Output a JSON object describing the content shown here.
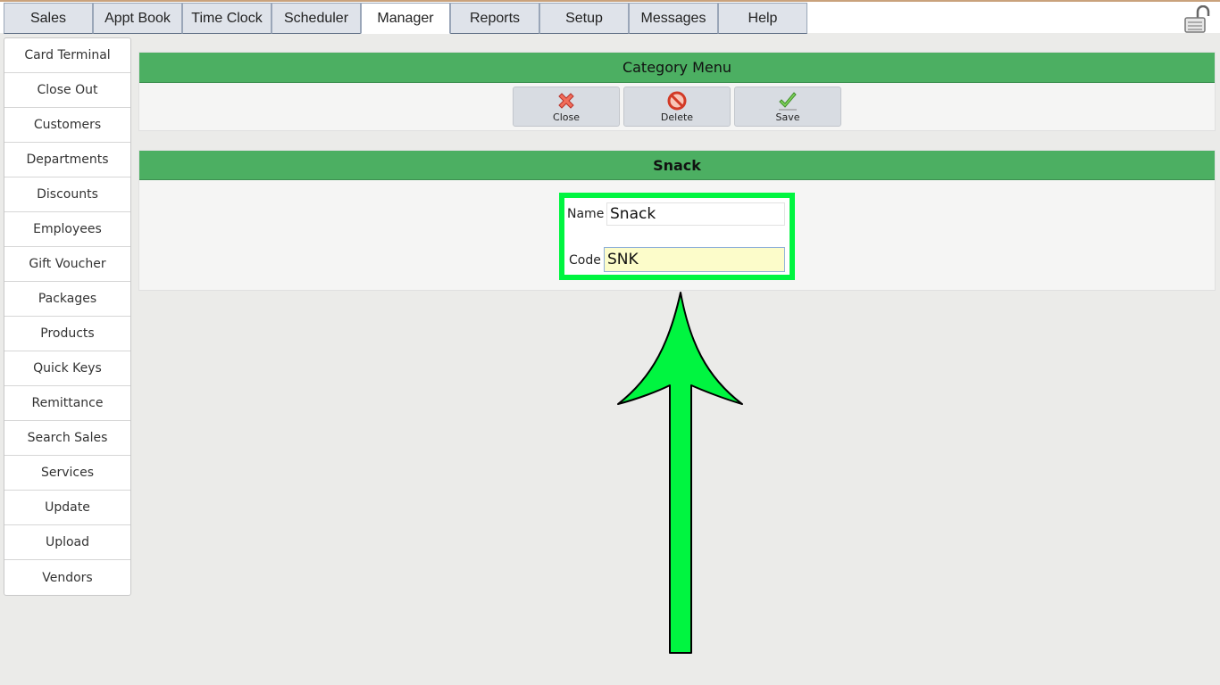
{
  "nav": {
    "tabs": [
      {
        "label": "Sales"
      },
      {
        "label": "Appt Book"
      },
      {
        "label": "Time Clock"
      },
      {
        "label": "Scheduler"
      },
      {
        "label": "Manager",
        "active": true
      },
      {
        "label": "Reports"
      },
      {
        "label": "Setup"
      },
      {
        "label": "Messages"
      },
      {
        "label": "Help"
      }
    ]
  },
  "sidebar": {
    "items": [
      {
        "label": "Card Terminal"
      },
      {
        "label": "Close Out"
      },
      {
        "label": "Customers"
      },
      {
        "label": "Departments"
      },
      {
        "label": "Discounts"
      },
      {
        "label": "Employees"
      },
      {
        "label": "Gift Voucher"
      },
      {
        "label": "Packages"
      },
      {
        "label": "Products"
      },
      {
        "label": "Quick Keys"
      },
      {
        "label": "Remittance"
      },
      {
        "label": "Search Sales"
      },
      {
        "label": "Services"
      },
      {
        "label": "Update"
      },
      {
        "label": "Upload"
      },
      {
        "label": "Vendors"
      }
    ]
  },
  "menu": {
    "title": "Category Menu",
    "buttons": {
      "close": "Close",
      "delete": "Delete",
      "save": "Save"
    }
  },
  "category": {
    "title": "Snack",
    "name_label": "Name",
    "name_value": "Snack",
    "code_label": "Code",
    "code_value": "SNK"
  },
  "colors": {
    "header_green": "#4caf62",
    "highlight_green": "#00f540",
    "code_field_bg": "#fcfcca"
  }
}
